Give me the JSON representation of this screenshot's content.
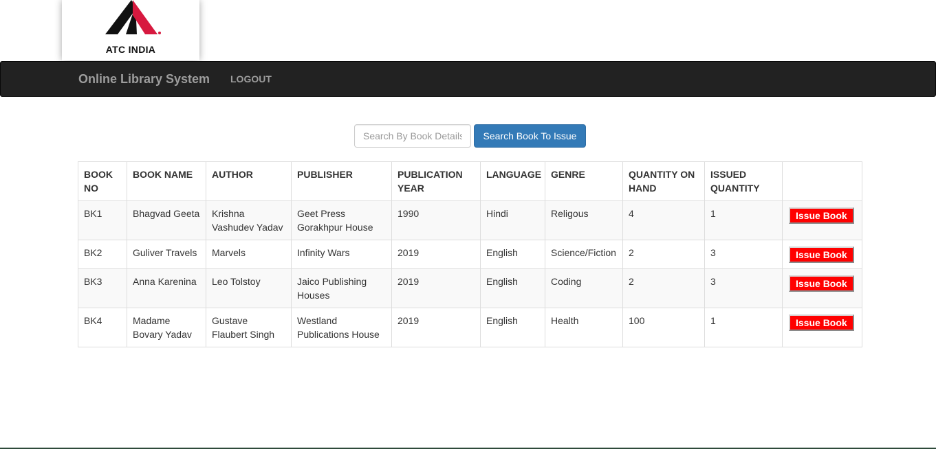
{
  "logo": {
    "text": "ATC INDIA",
    "colors": {
      "red": "#d7193f",
      "black": "#111111"
    }
  },
  "navbar": {
    "brand": "Online Library System",
    "logout_label": "LOGOUT",
    "background": "#222222"
  },
  "search": {
    "placeholder": "Search By Book Details",
    "value": "",
    "button_label": "Search Book To Issue"
  },
  "table": {
    "headers": {
      "book_no": "BOOK NO",
      "book_name": "BOOK NAME",
      "author": "AUTHOR",
      "publisher": "PUBLISHER",
      "publication_year": "PUBLICATION YEAR",
      "language": "LANGUAGE",
      "genre": "GENRE",
      "quantity_on_hand": "QUANTITY ON HAND",
      "issued_quantity": "ISSUED QUANTITY",
      "action": ""
    },
    "rows": [
      {
        "book_no": "BK1",
        "book_name": "Bhagvad Geeta",
        "author": "Krishna Vashudev Yadav",
        "publisher": "Geet Press Gorakhpur House",
        "publication_year": "1990",
        "language": "Hindi",
        "genre": "Religous",
        "quantity_on_hand": "4",
        "issued_quantity": "1",
        "action_label": "Issue Book"
      },
      {
        "book_no": "BK2",
        "book_name": "Guliver Travels",
        "author": "Marvels",
        "publisher": "Infinity Wars",
        "publication_year": "2019",
        "language": "English",
        "genre": "Science/Fiction",
        "quantity_on_hand": "2",
        "issued_quantity": "3",
        "action_label": "Issue Book"
      },
      {
        "book_no": "BK3",
        "book_name": "Anna Karenina",
        "author": "Leo Tolstoy",
        "publisher": "Jaico Publishing Houses",
        "publication_year": "2019",
        "language": "English",
        "genre": "Coding",
        "quantity_on_hand": "2",
        "issued_quantity": "3",
        "action_label": "Issue Book"
      },
      {
        "book_no": "BK4",
        "book_name": "Madame Bovary Yadav",
        "author": "Gustave Flaubert Singh",
        "publisher": "Westland Publications House",
        "publication_year": "2019",
        "language": "English",
        "genre": "Health",
        "quantity_on_hand": "100",
        "issued_quantity": "1",
        "action_label": "Issue Book"
      }
    ]
  },
  "colors": {
    "primary_button": "#337ab7",
    "issue_button": "#ff0000"
  }
}
